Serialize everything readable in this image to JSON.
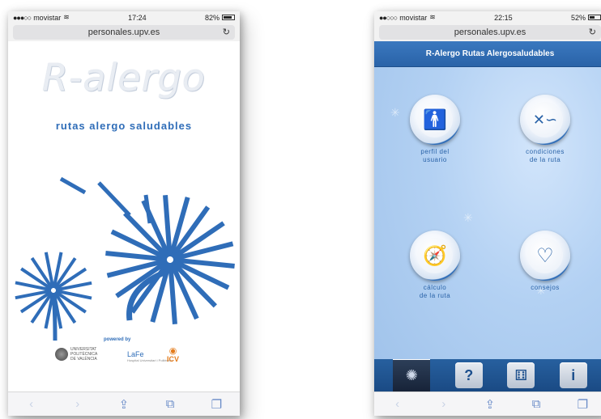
{
  "left_phone": {
    "status": {
      "carrier": "movistar",
      "time": "17:24",
      "battery": "82%",
      "battery_level": 0.82
    },
    "url": "personales.upv.es",
    "logo_text": "R-alergo",
    "subtitle": "rutas alergo saludables",
    "powered_by": "powered by",
    "sponsors": {
      "upv": [
        "UNIVERSITAT",
        "POLITÈCNICA",
        "DE VALÈNCIA"
      ],
      "lafe": "LaFe",
      "lafe_sub": "Hospital Universitari i Politècnic",
      "icv": "ICV"
    }
  },
  "right_phone": {
    "status": {
      "carrier": "movistar",
      "time": "22:15",
      "battery": "52%",
      "battery_level": 0.52
    },
    "url": "personales.upv.es",
    "app_title": "R-Alergo Rutas Alergosaludables",
    "tiles": [
      {
        "label_1": "perfil del",
        "label_2": "usuario",
        "icon": "person-icon"
      },
      {
        "label_1": "condiciones",
        "label_2": "de la ruta",
        "icon": "route-icon"
      },
      {
        "label_1": "cálculo",
        "label_2": "de la ruta",
        "icon": "compass-icon"
      },
      {
        "label_1": "consejos",
        "label_2": "",
        "icon": "heart-plus-icon"
      }
    ],
    "dock": [
      "dandelion-icon",
      "help-icon",
      "settings-icon",
      "info-icon"
    ]
  },
  "colors": {
    "brand_blue": "#2f6db8",
    "dock_blue": "#1a4a84",
    "browser_tint": "#6a8cc8"
  }
}
